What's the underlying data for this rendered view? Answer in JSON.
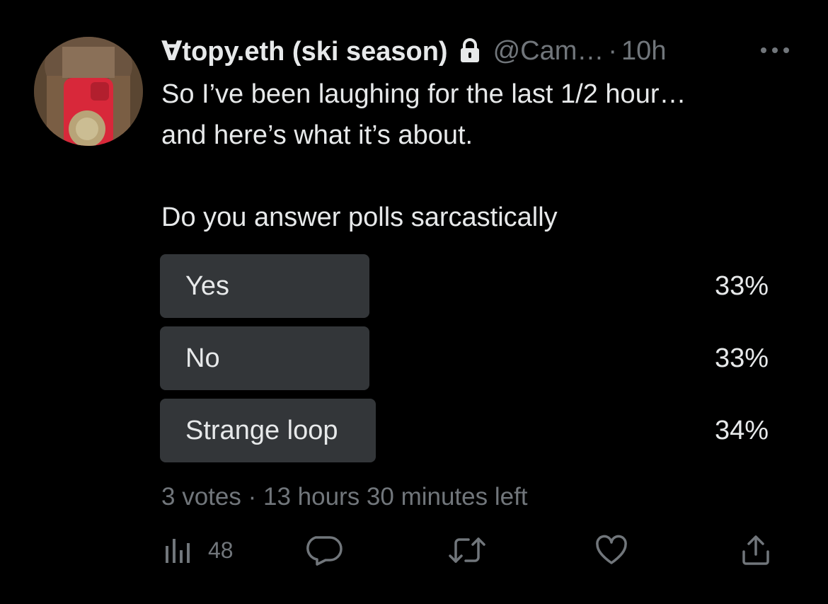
{
  "tweet": {
    "display_name": "∀topy.eth (ski season)",
    "handle": "@Cam…",
    "separator": "·",
    "timestamp": "10h",
    "text_lines": [
      "So I’ve been laughing for the last 1/2 hour…",
      "and here’s what it’s about.",
      "",
      "Do you answer polls sarcastically"
    ]
  },
  "poll": {
    "options": [
      {
        "label": "Yes",
        "percent_text": "33%",
        "percent": 33
      },
      {
        "label": "No",
        "percent_text": "33%",
        "percent": 33
      },
      {
        "label": "Strange loop",
        "percent_text": "34%",
        "percent": 34
      }
    ],
    "votes": "3 votes",
    "separator": "·",
    "time_left": "13 hours 30 minutes left"
  },
  "actions": {
    "views_count": "48"
  },
  "icons": {
    "lock": "lock-icon",
    "more": "more-icon",
    "views": "views-icon",
    "reply": "reply-icon",
    "retweet": "retweet-icon",
    "like": "like-icon",
    "share": "share-icon"
  },
  "colors": {
    "background": "#000000",
    "text": "#e7e9ea",
    "secondary": "#71767b",
    "poll_bar": "#333639"
  }
}
